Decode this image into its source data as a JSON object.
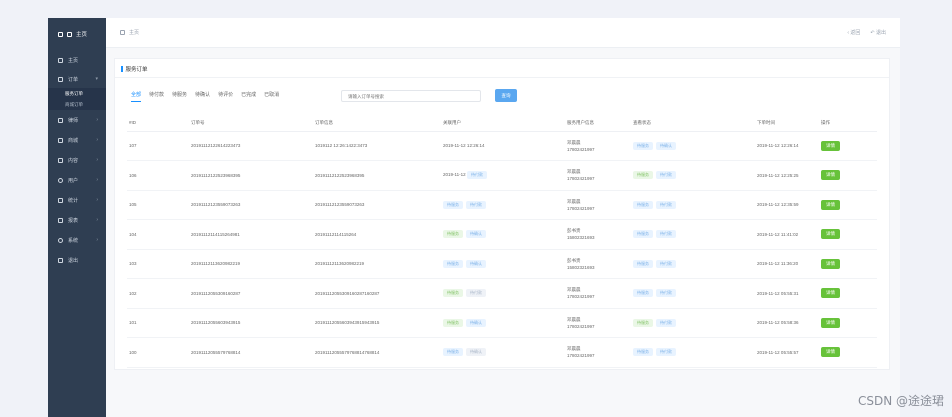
{
  "sidebar": {
    "brand": "主页",
    "items": [
      {
        "label": "主页",
        "icon": "home-icon"
      },
      {
        "label": "订单",
        "icon": "cart-icon",
        "expanded": true,
        "children": [
          {
            "label": "服务订单",
            "active": true
          },
          {
            "label": "商城订单",
            "active": false
          }
        ]
      },
      {
        "label": "律师",
        "icon": "users-icon"
      },
      {
        "label": "商城",
        "icon": "shop-icon"
      },
      {
        "label": "内容",
        "icon": "content-icon"
      },
      {
        "label": "用户",
        "icon": "user-icon"
      },
      {
        "label": "统计",
        "icon": "chart-icon"
      },
      {
        "label": "报表",
        "icon": "report-icon"
      },
      {
        "label": "系统",
        "icon": "gear-icon"
      },
      {
        "label": "退出",
        "icon": "logout-icon"
      }
    ]
  },
  "topbar": {
    "breadcrumb": "主页",
    "back_label": "返回",
    "logout_label": "退出"
  },
  "card": {
    "title": "服务订单",
    "tabs": [
      "全部",
      "待付款",
      "待服务",
      "待确认",
      "待评价",
      "已完成",
      "已取消"
    ],
    "search_placeholder": "请输入订单号搜索",
    "search_button": "查询"
  },
  "table": {
    "headers": [
      "#ID",
      "订单号",
      "订单信息",
      "关联用户",
      "服务用户信息",
      "查看状态",
      "下单时间",
      "操作"
    ],
    "detail_label": "详情",
    "rows": [
      {
        "id": "107",
        "order_no": "20191112122614223473",
        "order_info": "1019112 12:26:1422:3473",
        "user": "2019-11-12 12:26:14",
        "user_tags": [],
        "name": "邓晨晨",
        "phone": "17802421997",
        "status_tags": [
          [
            "待服务",
            "blue"
          ],
          [
            "待确认",
            "blue"
          ]
        ],
        "time": "2019-11-12 12:26:14"
      },
      {
        "id": "106",
        "order_no": "20191112122523968395",
        "order_info": "20191112122523968395",
        "user": "2019-11-12",
        "user_tags": [
          [
            "待付款",
            "blue"
          ]
        ],
        "name": "邓晨晨",
        "phone": "17802421997",
        "status_tags": [
          [
            "待服务",
            "green"
          ],
          [
            "待付款",
            "blue"
          ]
        ],
        "time": "2019-11-12 12:25:25"
      },
      {
        "id": "105",
        "order_no": "20191112123559073263",
        "order_info": "20191112123559073263",
        "user": "",
        "user_tags": [
          [
            "待服务",
            "blue"
          ],
          [
            "待付款",
            "blue"
          ]
        ],
        "name": "邓晨晨",
        "phone": "17802421997",
        "status_tags": [
          [
            "待服务",
            "blue"
          ],
          [
            "待付款",
            "blue"
          ]
        ],
        "time": "2019-11-12 12:35:59"
      },
      {
        "id": "104",
        "order_no": "20191112114115264981",
        "order_info": "20191112114115264",
        "user": "",
        "user_tags": [
          [
            "待服务",
            "green"
          ],
          [
            "待确认",
            "blue"
          ]
        ],
        "name": "彭书贵",
        "phone": "15802321693",
        "status_tags": [
          [
            "待服务",
            "blue"
          ],
          [
            "待付款",
            "blue"
          ]
        ],
        "time": "2019-11-12 11:41:02"
      },
      {
        "id": "103",
        "order_no": "20191112113620982219",
        "order_info": "20191112113620982219",
        "user": "",
        "user_tags": [
          [
            "待服务",
            "blue"
          ],
          [
            "待确认",
            "blue"
          ]
        ],
        "name": "彭书贵",
        "phone": "15802321693",
        "status_tags": [
          [
            "待服务",
            "blue"
          ],
          [
            "待付款",
            "blue"
          ]
        ],
        "time": "2019-11-12 11:36:20"
      },
      {
        "id": "102",
        "order_no": "20191112055309160287",
        "order_info": "20191112055309160287160287",
        "user": "",
        "user_tags": [
          [
            "待服务",
            "green"
          ],
          [
            "待付款",
            "gray"
          ]
        ],
        "name": "邓晨晨",
        "phone": "17802421997",
        "status_tags": [
          [
            "待服务",
            "blue"
          ],
          [
            "待付款",
            "blue"
          ]
        ],
        "time": "2019-11-12 05:55:31"
      },
      {
        "id": "101",
        "order_no": "20191112055603943915",
        "order_info": "20191112055603943915943915",
        "user": "",
        "user_tags": [
          [
            "待服务",
            "green"
          ],
          [
            "待确认",
            "blue"
          ]
        ],
        "name": "邓晨晨",
        "phone": "17802421997",
        "status_tags": [
          [
            "待服务",
            "green"
          ],
          [
            "待付款",
            "blue"
          ]
        ],
        "time": "2019-11-12 05:58:36"
      },
      {
        "id": "100",
        "order_no": "20191112055579768814",
        "order_info": "20191112055579768814768814",
        "user": "",
        "user_tags": [
          [
            "待服务",
            "blue"
          ],
          [
            "待确认",
            "gray"
          ]
        ],
        "name": "邓晨晨",
        "phone": "17802421997",
        "status_tags": [
          [
            "待服务",
            "blue"
          ],
          [
            "待付款",
            "blue"
          ]
        ],
        "time": "2019-11-12 05:55:57"
      }
    ]
  },
  "watermark": "CSDN @途途珺"
}
